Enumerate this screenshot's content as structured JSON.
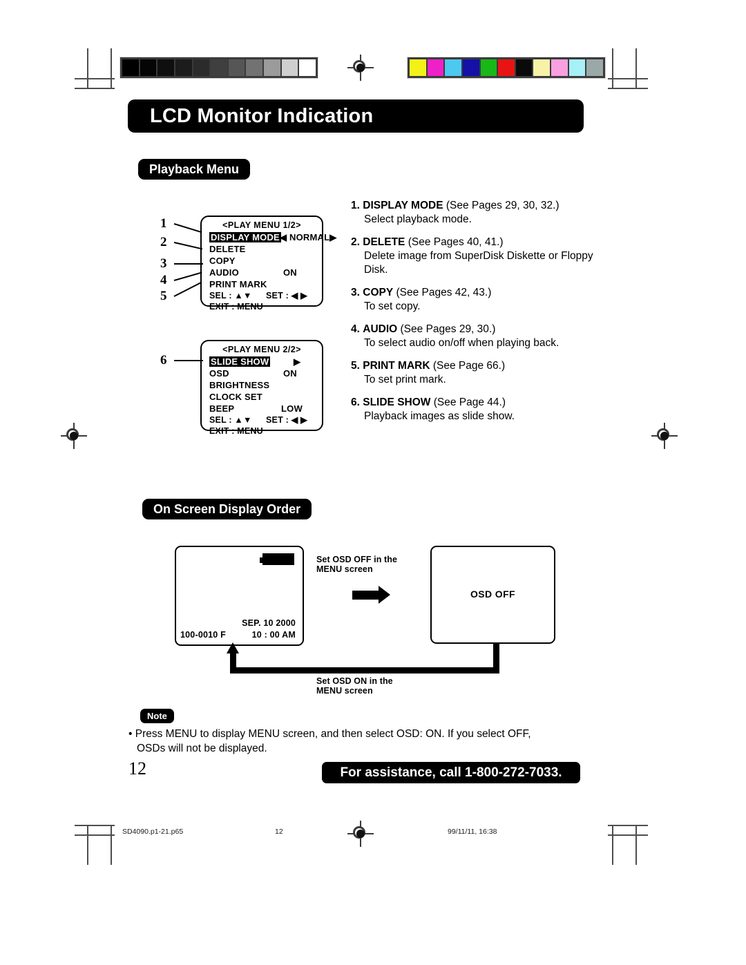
{
  "page": {
    "main_title": "LCD Monitor Indication",
    "page_number": "12",
    "assistance": "For assistance, call 1-800-272-7033."
  },
  "sections": {
    "playback_menu_label": "Playback Menu",
    "osd_order_label": "On Screen Display Order",
    "note_label": "Note"
  },
  "menu_screen_1": {
    "title": "<PLAY MENU 1/2>",
    "rows": [
      {
        "label": "DISPLAY MODE",
        "value": "◀ NORMAL▶",
        "highlighted": true
      },
      {
        "label": "DELETE",
        "value": "",
        "highlighted": false
      },
      {
        "label": "COPY",
        "value": "",
        "highlighted": false
      },
      {
        "label": "AUDIO",
        "value": "ON",
        "highlighted": false
      },
      {
        "label": "PRINT MARK",
        "value": "",
        "highlighted": false
      }
    ],
    "footer_sel": "SEL   : ▲▼",
    "footer_set": "SET   : ◀ ▶",
    "footer_exit": "EXIT  : MENU"
  },
  "menu_screen_2": {
    "title": "<PLAY MENU 2/2>",
    "rows": [
      {
        "label": "SLIDE SHOW",
        "value": "▶",
        "highlighted": true
      },
      {
        "label": "OSD",
        "value": "ON",
        "highlighted": false
      },
      {
        "label": "BRIGHTNESS",
        "value": "",
        "highlighted": false
      },
      {
        "label": "CLOCK SET",
        "value": "",
        "highlighted": false
      },
      {
        "label": "BEEP",
        "value": "LOW",
        "highlighted": false
      }
    ],
    "footer_sel": "SEL   : ▲▼",
    "footer_set": "SET   : ◀ ▶",
    "footer_exit": "EXIT  : MENU"
  },
  "callouts": [
    "1",
    "2",
    "3",
    "4",
    "5",
    "6"
  ],
  "descriptions": [
    {
      "number": "1.",
      "term": "DISPLAY MODE",
      "ref": "(See Pages 29, 30, 32.)",
      "body": "Select playback mode."
    },
    {
      "number": "2.",
      "term": "DELETE",
      "ref": "(See Pages 40, 41.)",
      "body": "Delete image from SuperDisk Diskette or Floppy Disk."
    },
    {
      "number": "3.",
      "term": "COPY",
      "ref": "(See Pages 42, 43.)",
      "body": "To set copy."
    },
    {
      "number": "4.",
      "term": "AUDIO",
      "ref": "(See Pages 29, 30.)",
      "body": "To select audio on/off when playing back."
    },
    {
      "number": "5.",
      "term": "PRINT MARK",
      "ref": "(See Page 66.)",
      "body": "To set print mark."
    },
    {
      "number": "6.",
      "term": "SLIDE SHOW",
      "ref": "(See Page 44.)",
      "body": "Playback images as slide show."
    }
  ],
  "osd_diagram": {
    "screen_on": {
      "file_id": "100-0010 F",
      "date": "SEP. 10  2000",
      "time": "10 : 00 AM",
      "battery_icon": "battery-full-icon"
    },
    "screen_off": {
      "label": "OSD OFF"
    },
    "label_off_line1": "Set OSD OFF in the",
    "label_off_line2": "MENU screen",
    "label_on_line1": "Set OSD ON in the",
    "label_on_line2": "MENU screen"
  },
  "note": {
    "line1": "• Press MENU to display MENU screen, and then select OSD: ON. If you select OFF,",
    "line2": "OSDs will not be displayed."
  },
  "printer_marks": {
    "file_name": "SD4090.p1-21.p65",
    "folio": "12",
    "timestamp": "99/11/11, 16:38"
  },
  "calibration": {
    "grayscale": [
      "#000000",
      "#050505",
      "#0f0f0f",
      "#1c1c1c",
      "#2b2b2b",
      "#3f3f3f",
      "#565656",
      "#727272",
      "#9b9b9b",
      "#cfcfcf",
      "#ffffff"
    ],
    "colors": [
      "#f2f219",
      "#ee20c8",
      "#4cc9f0",
      "#1410a8",
      "#18b818",
      "#e81414",
      "#0a0a0a",
      "#f7f2a8",
      "#f9a0e0",
      "#a8f0f7",
      "#9aa8a8"
    ]
  }
}
